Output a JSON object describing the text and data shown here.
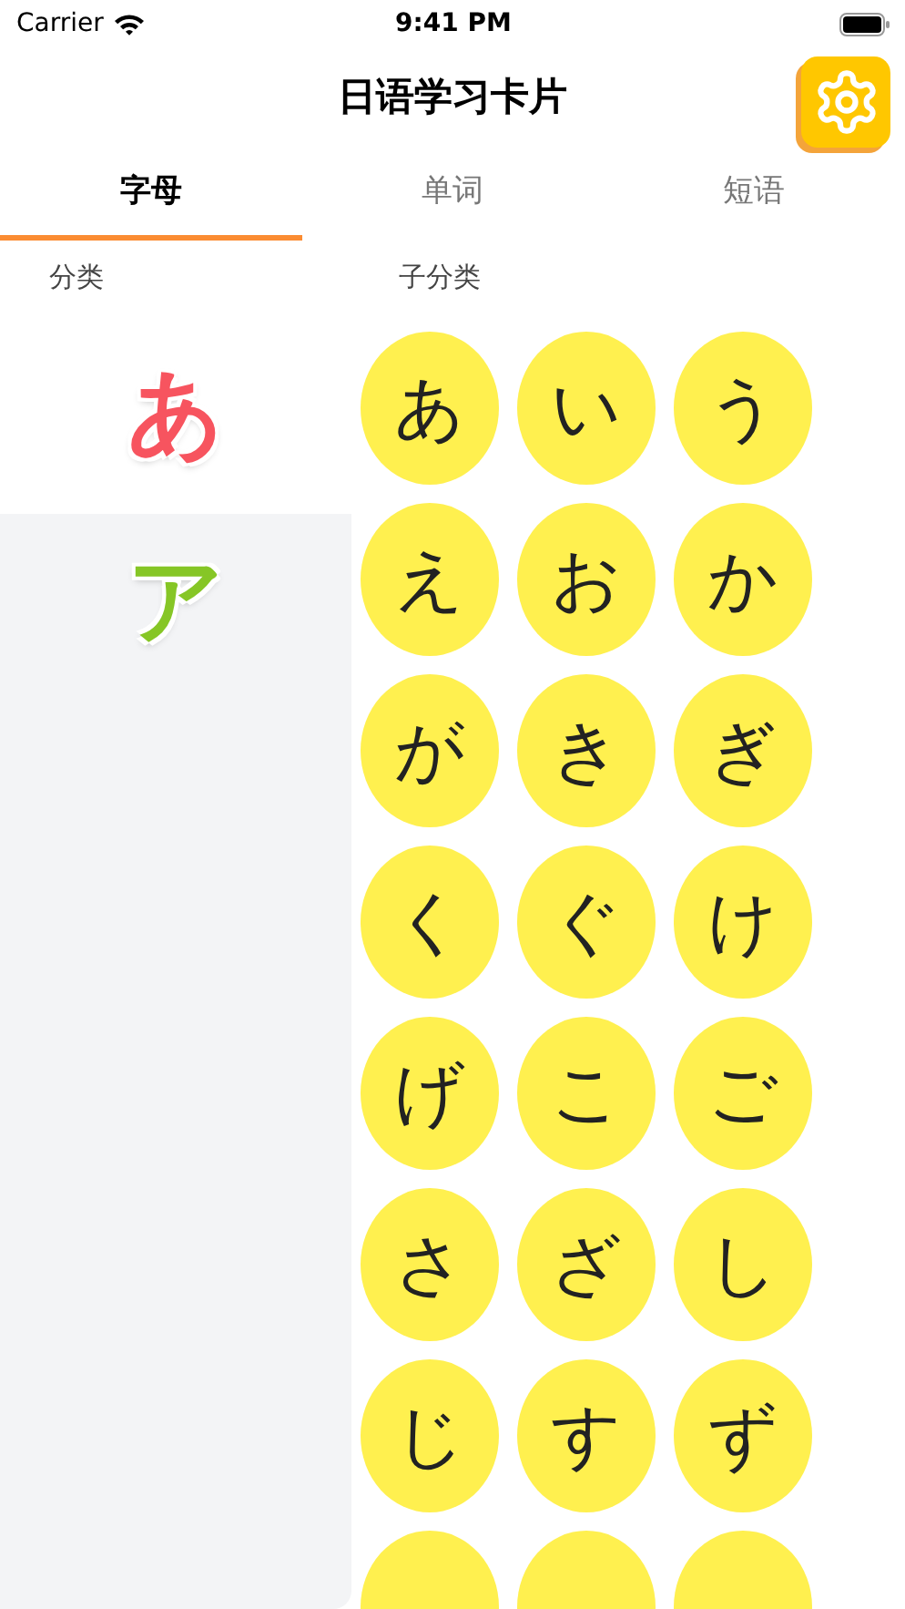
{
  "status_bar": {
    "carrier": "Carrier",
    "time": "9:41 PM"
  },
  "header": {
    "title": "日语学习卡片"
  },
  "tabs": [
    {
      "label": "字母",
      "selected": true
    },
    {
      "label": "单词",
      "selected": false
    },
    {
      "label": "短语",
      "selected": false
    }
  ],
  "category_panel": {
    "heading": "分类",
    "items": [
      {
        "label": "あ",
        "color": "#f7545f",
        "selected": true
      },
      {
        "label": "ア",
        "color": "#86c626",
        "selected": false
      }
    ]
  },
  "subcategory_panel": {
    "heading": "子分类",
    "items": [
      "あ",
      "い",
      "う",
      "え",
      "お",
      "か",
      "が",
      "き",
      "ぎ",
      "く",
      "ぐ",
      "け",
      "げ",
      "こ",
      "ご",
      "さ",
      "ざ",
      "し",
      "じ",
      "す",
      "ず"
    ]
  }
}
